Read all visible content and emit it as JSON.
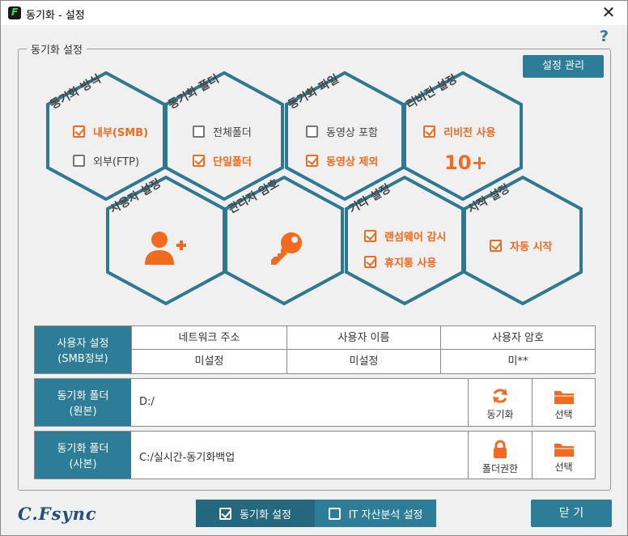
{
  "window": {
    "title": "동기화 - 설정",
    "close_symbol": "✕"
  },
  "help_symbol": "?",
  "group_legend": "동기화 설정",
  "manage_button": "설정 관리",
  "colors": {
    "accent": "#2d7d99",
    "highlight": "#f26a1f",
    "hex_stroke": "#2f7892"
  },
  "hexes": {
    "sync_method": {
      "title": "동기화 방식",
      "options": [
        {
          "label": "내부(SMB)",
          "checked": true
        },
        {
          "label": "외부(FTP)",
          "checked": false
        }
      ]
    },
    "sync_folder": {
      "title": "동기화 폴더",
      "options": [
        {
          "label": "전체폴더",
          "checked": false
        },
        {
          "label": "단일폴더",
          "checked": true
        }
      ]
    },
    "sync_file": {
      "title": "동기화 파일",
      "options": [
        {
          "label": "동영상 포함",
          "checked": false
        },
        {
          "label": "동영상 제외",
          "checked": true
        }
      ]
    },
    "revision": {
      "title": "리비전 설정",
      "option": {
        "label": "리비전 사용",
        "checked": true
      },
      "count": "10+"
    },
    "user": {
      "title": "사용자 설정",
      "icon": "add-user-icon"
    },
    "admin_pw": {
      "title": "관리자 암호",
      "icon": "key-icon"
    },
    "etc": {
      "title": "기타 설정",
      "options": [
        {
          "label": "랜섬웨어 감시",
          "checked": true
        },
        {
          "label": "휴지통 사용",
          "checked": true
        }
      ]
    },
    "start": {
      "title": "시작 설정",
      "option": {
        "label": "자동 시작",
        "checked": true
      }
    }
  },
  "user_table": {
    "head": "사용자 설정\n(SMB정보)",
    "columns": [
      "네트워크 주소",
      "사용자 이름",
      "사용자 암호"
    ],
    "values": [
      "미설정",
      "미설정",
      "미**"
    ]
  },
  "source_folder": {
    "head": "동기화 폴더\n(원본)",
    "path": "D:/",
    "action1": "동기화",
    "action1_icon": "refresh-icon",
    "action2": "선택",
    "action2_icon": "folder-icon"
  },
  "backup_folder": {
    "head": "동기화 폴더\n(사본)",
    "path": "C:/실시간-동기화백업",
    "action1": "폴더권한",
    "action1_icon": "lock-icon",
    "action2": "선택",
    "action2_icon": "folder-icon"
  },
  "bottom": {
    "logo": "C.Fsync",
    "tab_sync": "동기화 설정",
    "tab_it": "IT 자산분석 설정",
    "close": "닫 기"
  }
}
